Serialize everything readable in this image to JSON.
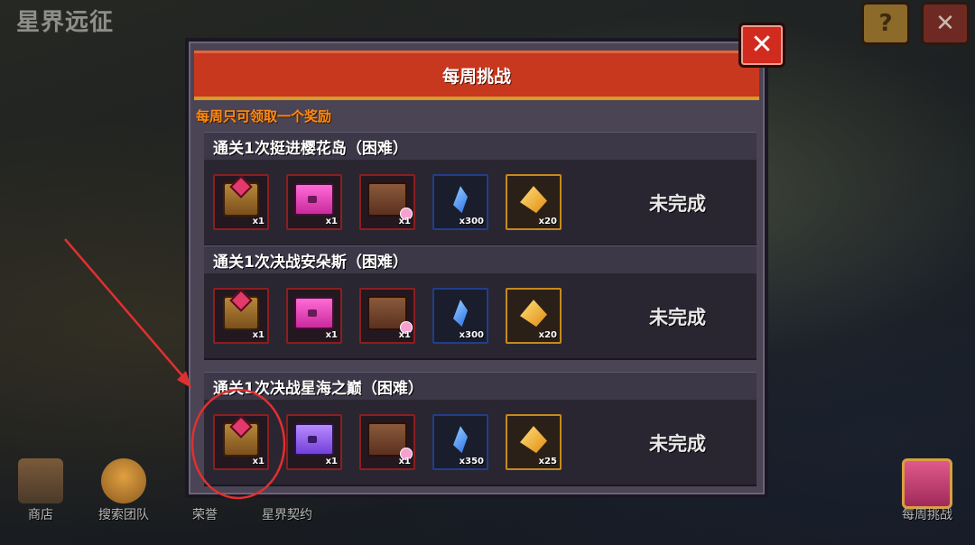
{
  "game": {
    "title": "星界远征"
  },
  "top_buttons": {
    "help": "?",
    "close": "✕"
  },
  "dialog": {
    "title": "每周挑战",
    "close": "✕",
    "notice": "每周只可领取一个奖励",
    "challenges": [
      {
        "title": "通关1次挺进樱花岛（困难）",
        "status": "未完成",
        "rewards": [
          {
            "icon": "red-gem-chest-icon",
            "qty": "x1"
          },
          {
            "icon": "pink-chest-icon",
            "qty": "x1"
          },
          {
            "icon": "brown-chest-icon",
            "qty": "x1"
          },
          {
            "icon": "blue-crystal-icon",
            "qty": "x300"
          },
          {
            "icon": "gold-crystal-icon",
            "qty": "x20"
          }
        ]
      },
      {
        "title": "通关1次决战安朵斯（困难）",
        "status": "未完成",
        "rewards": [
          {
            "icon": "red-gem-chest-icon",
            "qty": "x1"
          },
          {
            "icon": "pink-chest-icon",
            "qty": "x1"
          },
          {
            "icon": "brown-chest-icon",
            "qty": "x1"
          },
          {
            "icon": "blue-crystal-icon",
            "qty": "x300"
          },
          {
            "icon": "gold-crystal-icon",
            "qty": "x20"
          }
        ]
      },
      {
        "title": "通关1次决战星海之巅（困难）",
        "status": "未完成",
        "rewards": [
          {
            "icon": "red-gem-chest-icon",
            "qty": "x1"
          },
          {
            "icon": "purple-chest-icon",
            "qty": "x1"
          },
          {
            "icon": "brown-chest-icon",
            "qty": "x1"
          },
          {
            "icon": "blue-crystal-icon",
            "qty": "x350"
          },
          {
            "icon": "gold-crystal-icon",
            "qty": "x25"
          }
        ]
      }
    ]
  },
  "bottom_nav": [
    {
      "label": "商店"
    },
    {
      "label": "搜索团队"
    },
    {
      "label": "荣誉"
    },
    {
      "label": "星界契约"
    },
    {
      "label": "每周挑战"
    }
  ],
  "colors": {
    "header": "#c8381e",
    "notice": "#ff8a12",
    "annotation": "#e03030"
  }
}
